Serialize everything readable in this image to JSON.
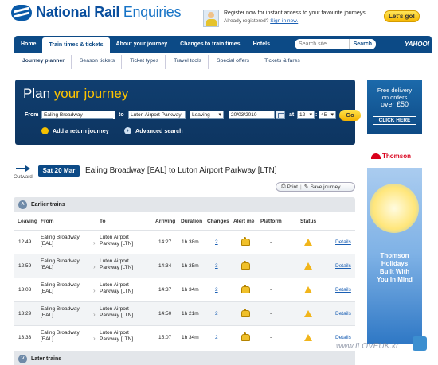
{
  "header": {
    "logo_main": "National Rail",
    "logo_sub": "Enquiries",
    "register_line1": "Register now for instant access to your favourite journeys",
    "register_line2_prefix": "Already registered?",
    "register_signin": "Sign in now.",
    "lets_go": "Let's go!"
  },
  "nav": {
    "tabs": [
      "Home",
      "Train times & tickets",
      "About your journey",
      "Changes to train times",
      "Hotels"
    ],
    "active_index": 1,
    "search_placeholder": "Search site",
    "search_button": "Search",
    "partner": "YAHOO!"
  },
  "subnav": {
    "items": [
      "Journey planner",
      "Season tickets",
      "Ticket types",
      "Travel tools",
      "Special offers",
      "Tickets & fares"
    ],
    "active_index": 0
  },
  "plan": {
    "title_1": "Plan",
    "title_2": "your journey",
    "from_label": "From",
    "from_value": "Ealing Broadway",
    "to_label": "to",
    "to_value": "Luton Airport Parkway",
    "leaving_value": "Leaving",
    "date_value": "20/03/2010",
    "at_label": "at",
    "hour_value": "12",
    "minute_value": "45",
    "colon": ":",
    "go": "Go",
    "return_link": "Add a return journey",
    "advanced_link": "Advanced search"
  },
  "journey": {
    "direction_label": "Outward",
    "date": "Sat 20 Mar",
    "route": "Ealing Broadway [EAL]  to  Luton Airport Parkway [LTN]",
    "print": "Print",
    "save": "Save journey"
  },
  "table": {
    "earlier": "Earlier trains",
    "later": "Later trains",
    "headers": [
      "Leaving",
      "From",
      "To",
      "Arriving",
      "Duration",
      "Changes",
      "Alert me",
      "Platform",
      "Status"
    ],
    "rows": [
      {
        "leaving": "12:49",
        "from_1": "Ealing Broadway",
        "from_2": "[EAL]",
        "to_1": "Luton Airport",
        "to_2": "Parkway [LTN]",
        "arriving": "14:27",
        "duration": "1h 38m",
        "changes": "2",
        "platform": "-",
        "details": "Details"
      },
      {
        "leaving": "12:59",
        "from_1": "Ealing Broadway",
        "from_2": "[EAL]",
        "to_1": "Luton Airport",
        "to_2": "Parkway [LTN]",
        "arriving": "14:34",
        "duration": "1h 35m",
        "changes": "3",
        "platform": "-",
        "details": "Details"
      },
      {
        "leaving": "13:03",
        "from_1": "Ealing Broadway",
        "from_2": "[EAL]",
        "to_1": "Luton Airport",
        "to_2": "Parkway [LTN]",
        "arriving": "14:37",
        "duration": "1h 34m",
        "changes": "2",
        "platform": "-",
        "details": "Details"
      },
      {
        "leaving": "13:29",
        "from_1": "Ealing Broadway",
        "from_2": "[EAL]",
        "to_1": "Luton Airport",
        "to_2": "Parkway [LTN]",
        "arriving": "14:50",
        "duration": "1h 21m",
        "changes": "2",
        "platform": "-",
        "details": "Details"
      },
      {
        "leaving": "13:33",
        "from_1": "Ealing Broadway",
        "from_2": "[EAL]",
        "to_1": "Luton Airport",
        "to_2": "Parkway [LTN]",
        "arriving": "15:07",
        "duration": "1h 34m",
        "changes": "2",
        "platform": "-",
        "details": "Details"
      }
    ]
  },
  "ads": {
    "delivery_line1": "Free delivery",
    "delivery_line2": "on orders",
    "delivery_line3": "over £50",
    "delivery_button": "CLICK HERE",
    "thomson_brand": "Thomson",
    "thomson_line1": "Thomson",
    "thomson_line2": "Holidays",
    "thomson_line3": "Built With",
    "thomson_line4": "You In Mind"
  },
  "watermark": "www.ILOVEUK.kr",
  "colors": {
    "brand_blue": "#0c4a86",
    "accent_yellow": "#ffc400",
    "link_blue": "#1a5fb4",
    "warning": "#f1b51b"
  }
}
